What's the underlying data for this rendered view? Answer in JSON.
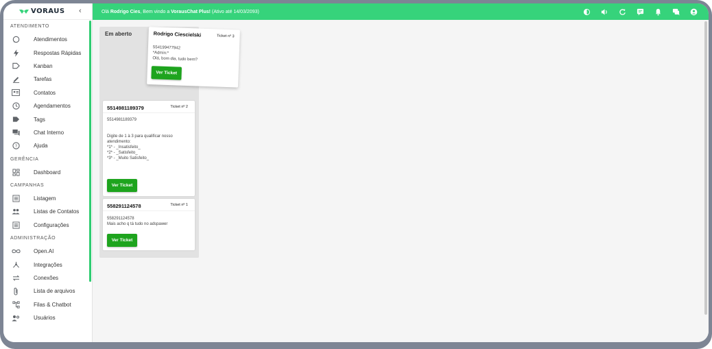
{
  "app": {
    "name": "VORAUS",
    "collapse_icon": "chevron-left"
  },
  "colors": {
    "accent": "#36d37b",
    "button": "#1ea41e",
    "frame": "#7d8594"
  },
  "topbar": {
    "greeting_prefix": "Olá ",
    "user": "Rodrigo Cies",
    "greeting_mid": ", Bem vindo a ",
    "product": "VorausChat Plus!",
    "greeting_suffix": " (Ativo até 14/03/2093)",
    "icons": [
      "dark-mode-icon",
      "volume-icon",
      "refresh-icon",
      "announcement-icon",
      "notifications-icon",
      "chat-icon",
      "account-icon"
    ]
  },
  "sidebar": {
    "sections": [
      {
        "title": "ATENDIMENTO",
        "items": [
          {
            "label": "Atendimentos",
            "icon": "whatsapp-icon"
          },
          {
            "label": "Respostas Rápidas",
            "icon": "bolt-icon"
          },
          {
            "label": "Kanban",
            "icon": "label-icon"
          },
          {
            "label": "Tarefas",
            "icon": "pencil-icon"
          },
          {
            "label": "Contatos",
            "icon": "contact-card-icon"
          },
          {
            "label": "Agendamentos",
            "icon": "clock-icon"
          },
          {
            "label": "Tags",
            "icon": "tag-icon"
          },
          {
            "label": "Chat Interno",
            "icon": "forum-icon"
          },
          {
            "label": "Ajuda",
            "icon": "help-icon"
          }
        ]
      },
      {
        "title": "GERÊNCIA",
        "items": [
          {
            "label": "Dashboard",
            "icon": "dashboard-icon"
          }
        ]
      },
      {
        "title": "CAMPANHAS",
        "items": [
          {
            "label": "Listagem",
            "icon": "list-icon"
          },
          {
            "label": "Listas de Contatos",
            "icon": "people-icon"
          },
          {
            "label": "Configurações",
            "icon": "list-settings-icon"
          }
        ]
      },
      {
        "title": "ADMINISTRAÇÃO",
        "items": [
          {
            "label": "Open.AI",
            "icon": "infinity-icon"
          },
          {
            "label": "Integrações",
            "icon": "hub-icon"
          },
          {
            "label": "Conexões",
            "icon": "sync-alt-icon"
          },
          {
            "label": "Lista de arquivos",
            "icon": "attach-icon"
          },
          {
            "label": "Filas & Chatbot",
            "icon": "account-tree-icon"
          },
          {
            "label": "Usuários",
            "icon": "users-icon"
          }
        ]
      }
    ]
  },
  "kanban": {
    "lane_title": "Em aberto",
    "button_label": "Ver Ticket",
    "dragging_card": {
      "name": "Rodrigo Ciescielski",
      "ticket": "Ticket nº 3",
      "body": "554199477942\n*Admin:*\nOlá, bom dia, tudo bem?"
    },
    "cards": [
      {
        "name": "5514981189379",
        "ticket": "Ticket nº 2",
        "body": "5514981189379\n\n\nDigite de 1 à 3 para qualificar nosso atendimento:\n*1* - _Insatisfeito_\n*2* - _Satisfeito_\n*3* - _Muito Satisfeito_"
      },
      {
        "name": "558291124578",
        "ticket": "Ticket nº 1",
        "body": "558291124578\nMais acho q tá tudo no adspawer"
      }
    ]
  }
}
